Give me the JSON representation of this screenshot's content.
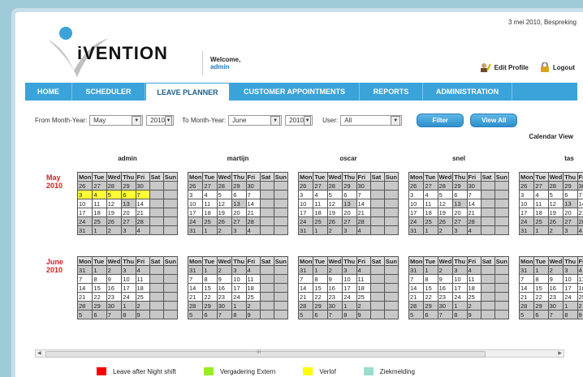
{
  "header": {
    "top_right_text": "3 mei 2010, Bespreking",
    "logo_text": "iVENTION",
    "welcome_label": "Welcome,",
    "welcome_user": "admin",
    "edit_profile_label": "Edit Profile",
    "logout_label": "Logout"
  },
  "nav": {
    "items": [
      {
        "label": "HOME"
      },
      {
        "label": "SCHEDULER"
      },
      {
        "label": "LEAVE PLANNER"
      },
      {
        "label": "CUSTOMER APPOINTMENTS"
      },
      {
        "label": "REPORTS"
      },
      {
        "label": "ADMINISTRATION"
      }
    ],
    "active_index": 2
  },
  "filter": {
    "from_label": "From Month-Year:",
    "from_month": "May",
    "from_year": "2010",
    "to_label": "To Month-Year:",
    "to_month": "June",
    "to_year": "2010",
    "user_label": "User:",
    "user_value": "All",
    "filter_button": "Filter",
    "view_all_button": "View All"
  },
  "calendar_view_label": "Calendar View",
  "day_headers": [
    "Mon",
    "Tue",
    "Wed",
    "Thu",
    "Fri",
    "Sat",
    "Sun"
  ],
  "users": [
    "admin",
    "martijn",
    "oscar",
    "snel",
    "tas"
  ],
  "months": [
    {
      "label_line1": "May",
      "label_line2": "2010",
      "weeks": [
        [
          "26",
          "27",
          "28",
          "29",
          "30",
          "",
          ""
        ],
        [
          "3",
          "4",
          "5",
          "6",
          "7",
          "",
          ""
        ],
        [
          "10",
          "11",
          "12",
          "13",
          "14",
          "",
          ""
        ],
        [
          "17",
          "18",
          "19",
          "20",
          "21",
          "",
          ""
        ],
        [
          "24",
          "25",
          "26",
          "27",
          "28",
          "",
          ""
        ],
        [
          "31",
          "1",
          "2",
          "3",
          "4",
          "",
          ""
        ]
      ]
    },
    {
      "label_line1": "June",
      "label_line2": "2010",
      "weeks": [
        [
          "31",
          "1",
          "2",
          "3",
          "4",
          "",
          ""
        ],
        [
          "7",
          "8",
          "9",
          "10",
          "11",
          "",
          ""
        ],
        [
          "14",
          "15",
          "16",
          "17",
          "18",
          "",
          ""
        ],
        [
          "21",
          "22",
          "23",
          "24",
          "25",
          "",
          ""
        ],
        [
          "28",
          "29",
          "30",
          "1",
          "2",
          "",
          ""
        ],
        [
          "5",
          "6",
          "7",
          "8",
          "9",
          "",
          ""
        ]
      ]
    }
  ],
  "highlights": {
    "admin_may_week2": "Verlof"
  },
  "legend": [
    {
      "label": "Leave after Night shift",
      "color": "#ff0000"
    },
    {
      "label": "Vergadering Extern",
      "color": "#99ee22"
    },
    {
      "label": "Verlof",
      "color": "#ffff00"
    },
    {
      "label": "Ziekmelding",
      "color": "#99ddcc"
    }
  ],
  "scroll_middle_mark": "III"
}
